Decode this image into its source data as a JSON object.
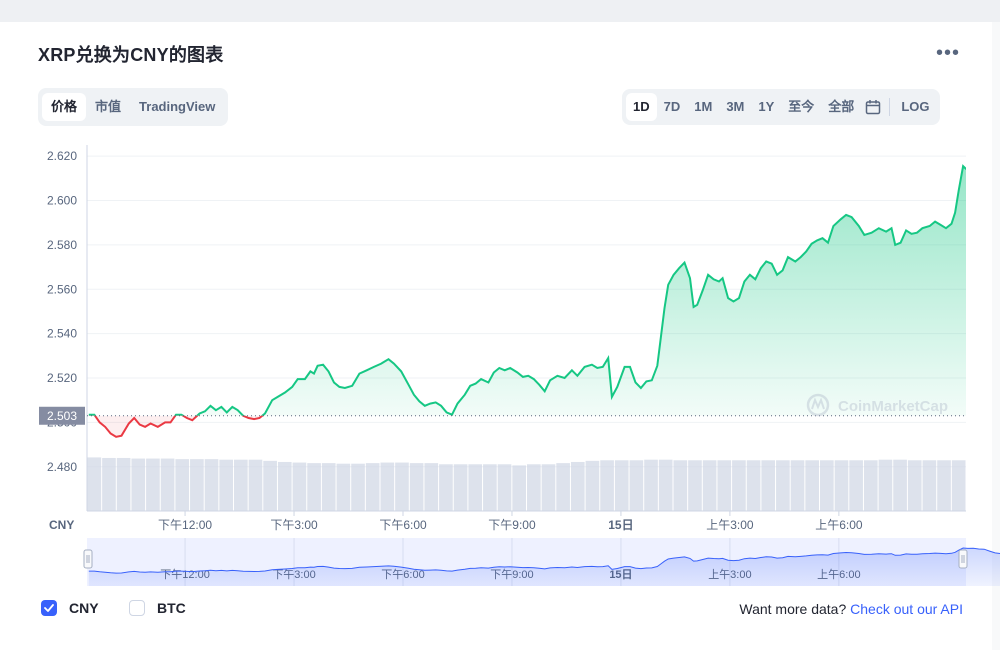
{
  "title": "XRP兑换为CNY的图表",
  "more_icon": "more-horizontal-icon",
  "tabs": [
    {
      "label": "价格",
      "active": true
    },
    {
      "label": "市值",
      "active": false
    },
    {
      "label": "TradingView",
      "active": false
    }
  ],
  "ranges": [
    {
      "label": "1D",
      "active": true
    },
    {
      "label": "7D",
      "active": false
    },
    {
      "label": "1M",
      "active": false
    },
    {
      "label": "3M",
      "active": false
    },
    {
      "label": "1Y",
      "active": false
    },
    {
      "label": "至今",
      "active": false
    },
    {
      "label": "全部",
      "active": false
    }
  ],
  "calendar_icon": "calendar-icon",
  "log_label": "LOG",
  "watermark": "CoinMarketCap",
  "footer": {
    "cny_label": "CNY",
    "btc_label": "BTC",
    "more_text": "Want more data?",
    "api_link": "Check out our API"
  },
  "colors": {
    "up": "#16c784",
    "down": "#ea3943",
    "accent": "#3861fb",
    "current_label_bg": "#858ca2"
  },
  "chart_data": {
    "type": "line",
    "x_axis_label": "CNY",
    "ylim": [
      2.47,
      2.625
    ],
    "yticks": [
      2.48,
      2.5,
      2.52,
      2.54,
      2.56,
      2.58,
      2.6,
      2.62
    ],
    "ytick_labels": [
      "2.480",
      "2.500",
      "2.520",
      "2.540",
      "2.560",
      "2.580",
      "2.600",
      "2.620"
    ],
    "xlim": [
      9.3,
      33.5
    ],
    "xticks": [
      12,
      15,
      18,
      21,
      24,
      27,
      30
    ],
    "xtick_labels": [
      "下午12:00",
      "下午3:00",
      "下午6:00",
      "下午9:00",
      "15日",
      "上午3:00",
      "上午6:00"
    ],
    "navigator_tick_labels": [
      "下午12:00",
      "下午3:00",
      "下午6:00",
      "下午9:00",
      "15日",
      "上午3:00",
      "上午6:00"
    ],
    "baseline": 2.503,
    "current_price_label": "2.503",
    "grid": true,
    "series": [
      {
        "values": [
          [
            9.35,
            2.5035
          ],
          [
            9.5,
            2.5035
          ],
          [
            9.65,
            2.5
          ],
          [
            9.8,
            2.498
          ],
          [
            9.95,
            2.495
          ],
          [
            10.1,
            2.4935
          ],
          [
            10.25,
            2.494
          ],
          [
            10.45,
            2.4995
          ],
          [
            10.6,
            2.502
          ],
          [
            10.75,
            2.499
          ],
          [
            10.9,
            2.498
          ],
          [
            11.05,
            2.4995
          ],
          [
            11.25,
            2.498
          ],
          [
            11.45,
            2.5
          ],
          [
            11.6,
            2.5
          ],
          [
            11.75,
            2.5035
          ],
          [
            11.9,
            2.5035
          ],
          [
            12.05,
            2.502
          ],
          [
            12.2,
            2.501
          ],
          [
            12.4,
            2.504
          ],
          [
            12.55,
            2.505
          ],
          [
            12.7,
            2.5075
          ],
          [
            12.85,
            2.5055
          ],
          [
            13.0,
            2.507
          ],
          [
            13.15,
            2.5045
          ],
          [
            13.3,
            2.507
          ],
          [
            13.45,
            2.5055
          ],
          [
            13.6,
            2.503
          ],
          [
            13.75,
            2.502
          ],
          [
            13.9,
            2.5015
          ],
          [
            14.05,
            2.502
          ],
          [
            14.2,
            2.504
          ],
          [
            14.4,
            2.51
          ],
          [
            14.55,
            2.5115
          ],
          [
            14.75,
            2.5135
          ],
          [
            14.95,
            2.516
          ],
          [
            15.1,
            2.5195
          ],
          [
            15.3,
            2.5195
          ],
          [
            15.45,
            2.523
          ],
          [
            15.55,
            2.522
          ],
          [
            15.65,
            2.5255
          ],
          [
            15.8,
            2.526
          ],
          [
            15.95,
            2.523
          ],
          [
            16.1,
            2.518
          ],
          [
            16.25,
            2.516
          ],
          [
            16.4,
            2.5155
          ],
          [
            16.6,
            2.5165
          ],
          [
            16.8,
            2.522
          ],
          [
            17.0,
            2.5235
          ],
          [
            17.2,
            2.525
          ],
          [
            17.4,
            2.5265
          ],
          [
            17.6,
            2.5285
          ],
          [
            17.75,
            2.5265
          ],
          [
            17.95,
            2.523
          ],
          [
            18.15,
            2.517
          ],
          [
            18.3,
            2.5125
          ],
          [
            18.45,
            2.5095
          ],
          [
            18.6,
            2.5075
          ],
          [
            18.75,
            2.5085
          ],
          [
            18.9,
            2.509
          ],
          [
            19.05,
            2.5075
          ],
          [
            19.2,
            2.5045
          ],
          [
            19.35,
            2.5035
          ],
          [
            19.5,
            2.5085
          ],
          [
            19.7,
            2.5125
          ],
          [
            19.85,
            2.5165
          ],
          [
            20.0,
            2.5175
          ],
          [
            20.15,
            2.5195
          ],
          [
            20.35,
            2.518
          ],
          [
            20.5,
            2.5225
          ],
          [
            20.65,
            2.5245
          ],
          [
            20.8,
            2.5235
          ],
          [
            20.95,
            2.5245
          ],
          [
            21.15,
            2.5225
          ],
          [
            21.3,
            2.5205
          ],
          [
            21.45,
            2.521
          ],
          [
            21.6,
            2.5195
          ],
          [
            21.75,
            2.517
          ],
          [
            21.9,
            2.514
          ],
          [
            22.05,
            2.519
          ],
          [
            22.25,
            2.521
          ],
          [
            22.45,
            2.52
          ],
          [
            22.65,
            2.5235
          ],
          [
            22.8,
            2.521
          ],
          [
            23.0,
            2.525
          ],
          [
            23.2,
            2.526
          ],
          [
            23.35,
            2.5245
          ],
          [
            23.5,
            2.525
          ],
          [
            23.65,
            2.529
          ],
          [
            23.75,
            2.5115
          ],
          [
            23.9,
            2.516
          ],
          [
            24.1,
            2.525
          ],
          [
            24.25,
            2.525
          ],
          [
            24.4,
            2.518
          ],
          [
            24.55,
            2.5155
          ],
          [
            24.7,
            2.5185
          ],
          [
            24.85,
            2.519
          ],
          [
            25.0,
            2.5255
          ],
          [
            25.1,
            2.5385
          ],
          [
            25.2,
            2.5515
          ],
          [
            25.3,
            2.562
          ],
          [
            25.45,
            2.5665
          ],
          [
            25.6,
            2.5695
          ],
          [
            25.75,
            2.572
          ],
          [
            25.9,
            2.565
          ],
          [
            26.0,
            2.552
          ],
          [
            26.1,
            2.553
          ],
          [
            26.25,
            2.5595
          ],
          [
            26.4,
            2.5665
          ],
          [
            26.55,
            2.5645
          ],
          [
            26.7,
            2.5635
          ],
          [
            26.8,
            2.565
          ],
          [
            26.95,
            2.556
          ],
          [
            27.1,
            2.5545
          ],
          [
            27.25,
            2.556
          ],
          [
            27.4,
            2.5635
          ],
          [
            27.55,
            2.5665
          ],
          [
            27.7,
            2.5645
          ],
          [
            27.85,
            2.5695
          ],
          [
            28.0,
            2.5725
          ],
          [
            28.15,
            2.5715
          ],
          [
            28.3,
            2.5665
          ],
          [
            28.45,
            2.5685
          ],
          [
            28.6,
            2.5745
          ],
          [
            28.8,
            2.5725
          ],
          [
            28.95,
            2.5745
          ],
          [
            29.1,
            2.577
          ],
          [
            29.25,
            2.5805
          ],
          [
            29.4,
            2.582
          ],
          [
            29.55,
            2.583
          ],
          [
            29.7,
            2.581
          ],
          [
            29.85,
            2.5885
          ],
          [
            30.05,
            2.5915
          ],
          [
            30.2,
            2.5935
          ],
          [
            30.35,
            2.5925
          ],
          [
            30.55,
            2.5885
          ],
          [
            30.7,
            2.5845
          ],
          [
            30.9,
            2.5855
          ],
          [
            31.1,
            2.5875
          ],
          [
            31.3,
            2.586
          ],
          [
            31.45,
            2.5875
          ],
          [
            31.55,
            2.58
          ],
          [
            31.7,
            2.581
          ],
          [
            31.85,
            2.5865
          ],
          [
            32.0,
            2.585
          ],
          [
            32.15,
            2.5855
          ],
          [
            32.3,
            2.5875
          ],
          [
            32.5,
            2.5885
          ],
          [
            32.65,
            2.5905
          ],
          [
            32.8,
            2.589
          ],
          [
            32.95,
            2.5875
          ],
          [
            33.1,
            2.5895
          ],
          [
            33.2,
            2.5945
          ],
          [
            33.3,
            2.6045
          ],
          [
            33.42,
            2.6155
          ],
          [
            33.55,
            2.6135
          ],
          [
            33.7,
            2.6145
          ],
          [
            33.85,
            2.6105
          ],
          [
            34.0,
            2.6095
          ],
          [
            34.15,
            2.6005
          ],
          [
            34.3,
            2.5915
          ],
          [
            34.5,
            2.5875
          ],
          [
            34.65,
            2.5895
          ],
          [
            34.75,
            2.5885
          ]
        ]
      }
    ],
    "volume": {
      "comment_free": true,
      "levels": [
        0.94,
        0.93,
        0.93,
        0.92,
        0.92,
        0.92,
        0.91,
        0.91,
        0.91,
        0.9,
        0.9,
        0.9,
        0.88,
        0.86,
        0.85,
        0.84,
        0.84,
        0.83,
        0.83,
        0.84,
        0.85,
        0.85,
        0.84,
        0.84,
        0.82,
        0.82,
        0.82,
        0.82,
        0.82,
        0.8,
        0.82,
        0.82,
        0.84,
        0.86,
        0.88,
        0.89,
        0.89,
        0.89,
        0.9,
        0.9,
        0.89,
        0.89,
        0.89,
        0.89,
        0.89,
        0.89,
        0.89,
        0.89,
        0.89,
        0.89,
        0.89,
        0.89,
        0.89,
        0.89,
        0.9,
        0.9,
        0.89,
        0.89,
        0.89,
        0.89
      ]
    }
  }
}
